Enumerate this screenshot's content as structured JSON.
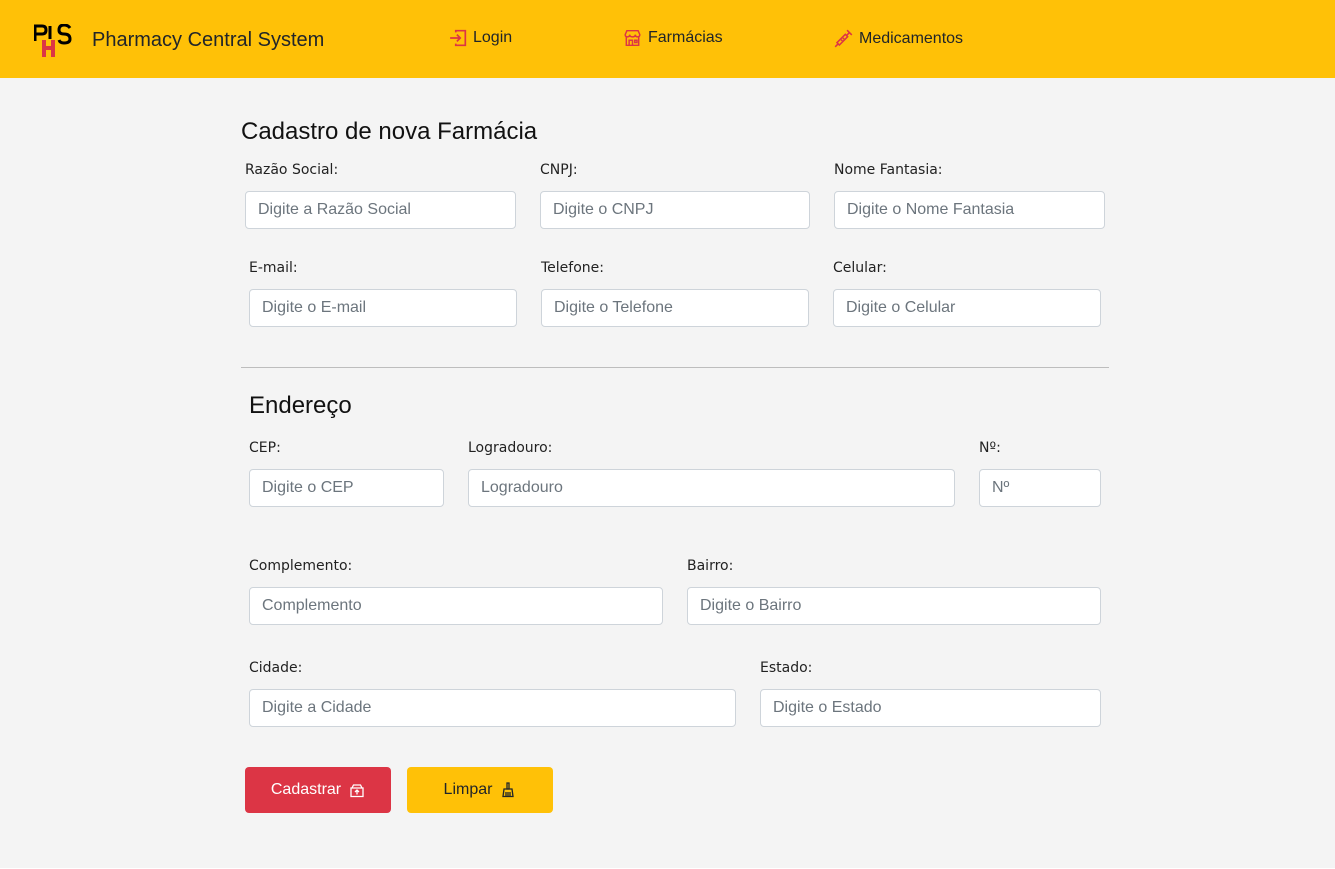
{
  "navbar": {
    "brand": "Pharmacy Central System",
    "links": [
      {
        "label": "Login",
        "icon": "login-icon"
      },
      {
        "label": "Farmácias",
        "icon": "store-icon"
      },
      {
        "label": "Medicamentos",
        "icon": "syringe-icon"
      }
    ],
    "logo_text": "PHS",
    "colors": {
      "bar": "#ffc107",
      "icon": "#dc3545"
    }
  },
  "form": {
    "title": "Cadastro de nova Farmácia",
    "fields": {
      "razao_social": {
        "label": "Razão Social:",
        "placeholder": "Digite a Razão Social",
        "value": ""
      },
      "cnpj": {
        "label": "CNPJ:",
        "placeholder": "Digite o CNPJ",
        "value": ""
      },
      "nome_fantasia": {
        "label": "Nome Fantasia:",
        "placeholder": "Digite o Nome Fantasia",
        "value": ""
      },
      "email": {
        "label": "E-mail:",
        "placeholder": "Digite o E-mail",
        "value": ""
      },
      "telefone": {
        "label": "Telefone:",
        "placeholder": "Digite o Telefone",
        "value": ""
      },
      "celular": {
        "label": "Celular:",
        "placeholder": "Digite o Celular",
        "value": ""
      }
    }
  },
  "address": {
    "title": "Endereço",
    "fields": {
      "cep": {
        "label": "CEP:",
        "placeholder": "Digite o CEP",
        "value": ""
      },
      "logradouro": {
        "label": "Logradouro:",
        "placeholder": "Logradouro",
        "value": ""
      },
      "numero": {
        "label": "Nº:",
        "placeholder": "Nº",
        "value": ""
      },
      "complemento": {
        "label": "Complemento:",
        "placeholder": "Complemento",
        "value": ""
      },
      "bairro": {
        "label": "Bairro:",
        "placeholder": "Digite o Bairro",
        "value": ""
      },
      "cidade": {
        "label": "Cidade:",
        "placeholder": "Digite a Cidade",
        "value": ""
      },
      "estado": {
        "label": "Estado:",
        "placeholder": "Digite o Estado",
        "value": ""
      }
    }
  },
  "actions": {
    "submit": {
      "label": "Cadastrar",
      "icon": "box-upload-icon",
      "color": "#dc3545"
    },
    "clear": {
      "label": "Limpar",
      "icon": "broom-icon",
      "color": "#ffc107"
    }
  }
}
